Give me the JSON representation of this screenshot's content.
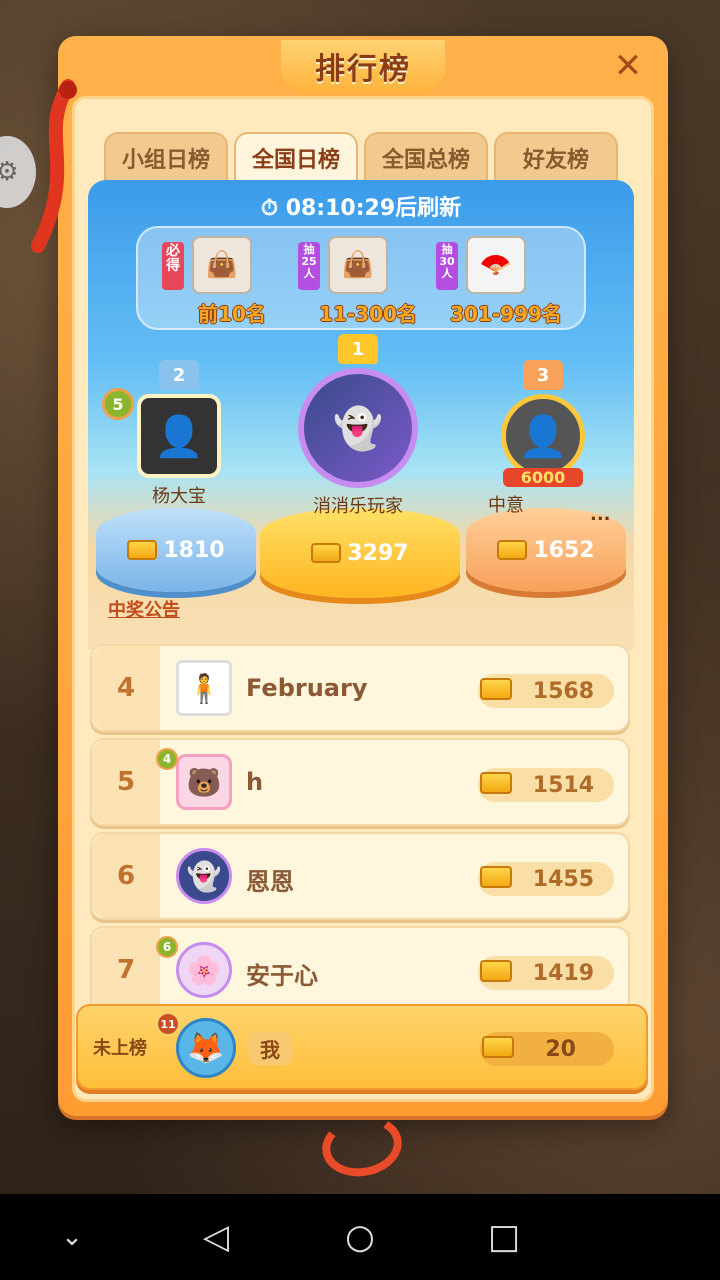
{
  "title": "排行榜",
  "tabs": [
    {
      "label": "小组日榜",
      "active": false
    },
    {
      "label": "全国日榜",
      "active": true
    },
    {
      "label": "全国总榜",
      "active": false
    },
    {
      "label": "好友榜",
      "active": false
    }
  ],
  "timer": "08:10:29后刷新",
  "prizes": [
    {
      "tag": "必得",
      "range": "前10名",
      "tag_color": "#e8465a"
    },
    {
      "tag": "抽25人",
      "range": "11-300名",
      "tag_color": "#b34ee0"
    },
    {
      "tag": "抽30人",
      "range": "301-999名",
      "tag_color": "#b34ee0"
    }
  ],
  "podium": [
    {
      "rank": "2",
      "name": "杨大宝",
      "score": "1810",
      "level": "5",
      "color": "#7ab5e8"
    },
    {
      "rank": "1",
      "name": "消消乐玩家",
      "score": "3297",
      "color": "#ffb520"
    },
    {
      "rank": "3",
      "name": "中意",
      "score": "1652",
      "badge": "6000",
      "more": "...",
      "color": "#f7a15a"
    }
  ],
  "notice_label": "中奖公告",
  "rows": [
    {
      "rank": "4",
      "name": "February",
      "score": "1568"
    },
    {
      "rank": "5",
      "name": "h",
      "score": "1514",
      "level": "4"
    },
    {
      "rank": "6",
      "name": "恩恩",
      "score": "1455"
    },
    {
      "rank": "7",
      "name": "安于心",
      "score": "1419",
      "level": "6"
    }
  ],
  "me": {
    "rank_label": "未上榜",
    "name": "我",
    "score": "20",
    "level": "11"
  },
  "nav": {
    "back": "◁",
    "home": "○",
    "recent": "□",
    "down": "⌄"
  }
}
